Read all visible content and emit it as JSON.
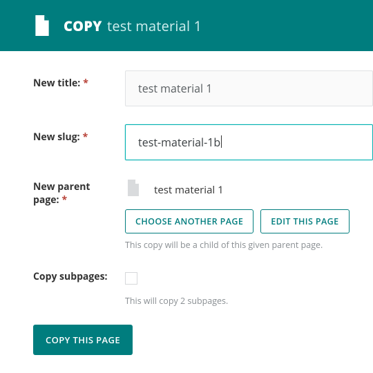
{
  "header": {
    "bold": "COPY",
    "rest": "test material 1",
    "icon": "document-icon"
  },
  "fields": {
    "title": {
      "label": "New title:",
      "value": "test material 1",
      "required": true
    },
    "slug": {
      "label": "New slug:",
      "value": "test-material-1b",
      "required": true
    },
    "parent": {
      "label": "New parent page:",
      "required": true,
      "page_name": "test material 1",
      "choose_label": "CHOOSE ANOTHER PAGE",
      "edit_label": "EDIT THIS PAGE",
      "help": "This copy will be a child of this given parent page."
    },
    "subpages": {
      "label": "Copy subpages:",
      "checked": false,
      "help": "This will copy 2 subpages."
    }
  },
  "submit": {
    "label": "COPY THIS PAGE"
  },
  "required_marker": "*"
}
